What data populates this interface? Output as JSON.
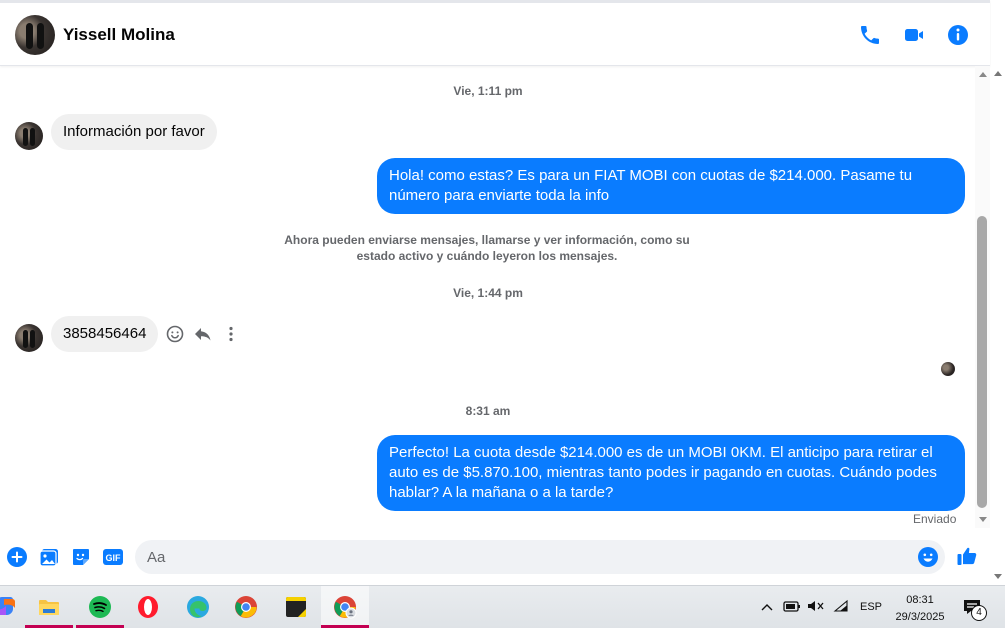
{
  "contact": {
    "name": "Yissell Molina"
  },
  "header_icons": [
    "phone-icon",
    "video-camera-icon",
    "info-icon"
  ],
  "messages": {
    "ts1": "Vie, 1:11 pm",
    "in1": "Información  por favor",
    "out1": "Hola! como estas? Es para un FIAT MOBI con cuotas de $214.000. Pasame tu número para enviarte toda la info",
    "notice": "Ahora pueden enviarse mensajes, llamarse y ver información, como su estado activo y cuándo leyeron los mensajes.",
    "ts2": "Vie, 1:44 pm",
    "in2": "3858456464",
    "ts3": "8:31 am",
    "out2": "Perfecto! La cuota desde $214.000 es de un MOBI 0KM. El anticipo para retirar el auto es de $5.870.100, mientras tanto podes ir pagando en cuotas. Cuándo podes hablar? A la mañana o a la tarde?",
    "status": "Enviado"
  },
  "composer": {
    "placeholder": "Aa"
  },
  "colors": {
    "accent": "#0a7cff",
    "incoming_bubble": "#f0f0f0",
    "muted_text": "#65676b"
  },
  "taskbar": {
    "apps": [
      "copilot",
      "file-explorer",
      "spotify",
      "opera",
      "edge",
      "chrome",
      "sticky-notes",
      "chrome-profile"
    ],
    "tray": {
      "language": "ESP",
      "time": "08:31",
      "date": "29/3/2025",
      "notification_count": "4"
    }
  }
}
